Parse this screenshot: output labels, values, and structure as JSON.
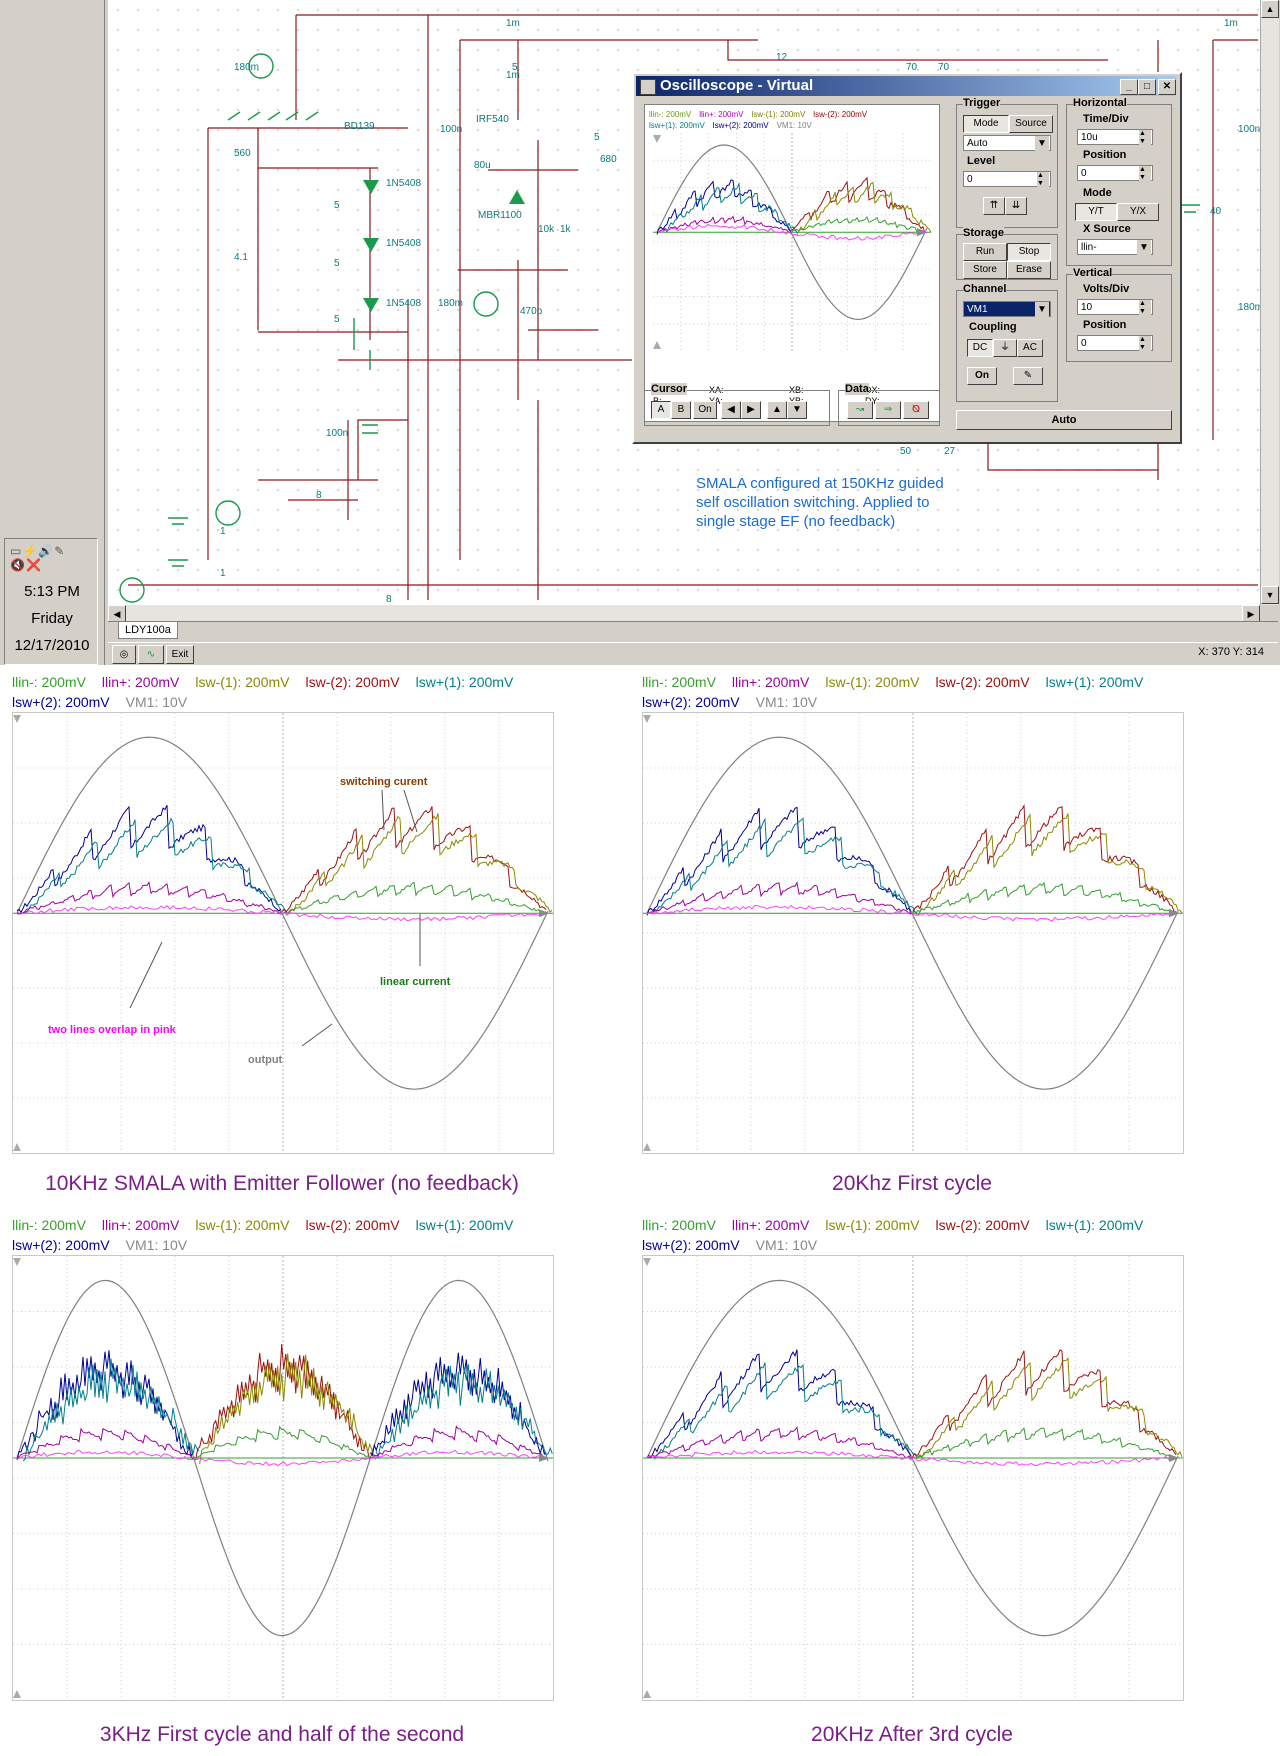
{
  "taskbar": {
    "time": "5:13 PM",
    "day": "Friday",
    "date": "12/17/2010"
  },
  "schematic": {
    "labels": [
      "1m",
      "12",
      "1m",
      "180m",
      "BD139",
      "560",
      "4.1",
      "5",
      "5",
      "5",
      "1N5408",
      "1N5408",
      "1N5408",
      "100n",
      "IRF540",
      "80u",
      "MBR1100",
      "10k",
      "1k",
      "470p",
      "100n",
      "8",
      "1",
      "1",
      "8",
      "180m",
      "40",
      "100n",
      "180m",
      "70",
      "70",
      "50",
      "27",
      "5",
      "680",
      "5",
      "1m"
    ],
    "note": "SMALA configured at 150KHz guided self oscillation switching. Applied to single stage EF (no feedback)"
  },
  "sheet_tab": "LDY100a",
  "statusbar": {
    "exit_label": "Exit",
    "coords": "X: 370  Y: 314"
  },
  "oscilloscope": {
    "title": "Oscilloscope - Virtual",
    "trigger": {
      "group": "Trigger",
      "mode": "Mode",
      "source": "Source",
      "mode_value": "Auto",
      "level_label": "Level",
      "level_value": "0"
    },
    "horizontal": {
      "group": "Horizontal",
      "time_div_label": "Time/Div",
      "time_div_value": "10u",
      "position_label": "Position",
      "position_value": "0",
      "mode_label": "Mode",
      "yt": "Y/T",
      "yx": "Y/X",
      "xsource_label": "X Source",
      "xsource_value": "llin-"
    },
    "storage": {
      "group": "Storage",
      "run": "Run",
      "stop": "Stop",
      "store": "Store",
      "erase": "Erase"
    },
    "channel": {
      "group": "Channel",
      "value": "VM1",
      "coupling_label": "Coupling",
      "dc": "DC",
      "ac": "AC",
      "on": "On"
    },
    "vertical": {
      "group": "Vertical",
      "volts_div_label": "Volts/Div",
      "volts_div_value": "10",
      "position_label": "Position",
      "position_value": "0"
    },
    "cursor": {
      "group": "Cursor",
      "a": "A",
      "b": "B",
      "on": "On"
    },
    "data": {
      "group": "Data"
    },
    "auto": "Auto",
    "readouts": {
      "a": "A:",
      "b": "B:",
      "xa": "XA:",
      "ya": "YA:",
      "xb": "XB:",
      "yb": "YB:",
      "dx": "DX:",
      "dy": "DY:"
    },
    "mini_legend_line1": [
      {
        "text": "llin-: 200mV",
        "color": "#6e9a00"
      },
      {
        "text": "llin+: 200mV",
        "color": "#b000b0"
      },
      {
        "text": "lsw-(1): 200mV",
        "color": "#808000"
      },
      {
        "text": "lsw-(2): 200mV",
        "color": "#a00000"
      }
    ],
    "mini_legend_line2": [
      {
        "text": "lsw+(1): 200mV",
        "color": "#00808a"
      },
      {
        "text": "lsw+(2): 200mV",
        "color": "#000090"
      },
      {
        "text": "VM1: 10V",
        "color": "#808080"
      }
    ]
  },
  "legend_line1": [
    {
      "text": "llin-: 200mV",
      "color": "#33a02c"
    },
    {
      "text": "llin+: 200mV",
      "color": "#a000a0"
    },
    {
      "text": "lsw-(1): 200mV",
      "color": "#8a8a00"
    },
    {
      "text": "lsw-(2): 200mV",
      "color": "#a01010"
    },
    {
      "text": "lsw+(1): 200mV",
      "color": "#00808a"
    }
  ],
  "legend_line2": [
    {
      "text": "lsw+(2): 200mV",
      "color": "#00009a"
    },
    {
      "text": "VM1: 10V",
      "color": "#888888"
    }
  ],
  "panels": [
    {
      "caption": "10KHz SMALA with Emitter Follower (no feedback)"
    },
    {
      "caption": "20Khz First cycle"
    },
    {
      "caption": "3KHz First cycle and half of the second"
    },
    {
      "caption": "20KHz After 3rd cycle"
    }
  ],
  "annotations": {
    "switching": "switching curent",
    "linear": "linear current",
    "pink": "two lines overlap in pink",
    "output": "output"
  },
  "colors": {
    "output": "#808080",
    "llin_minus": "#33a02c",
    "llin_plus": "#a000a0",
    "lsw_minus_1": "#8a8a00",
    "lsw_minus_2": "#a01010",
    "lsw_plus_1": "#00808a",
    "lsw_plus_2": "#00009a",
    "pink": "#ff40ff"
  }
}
